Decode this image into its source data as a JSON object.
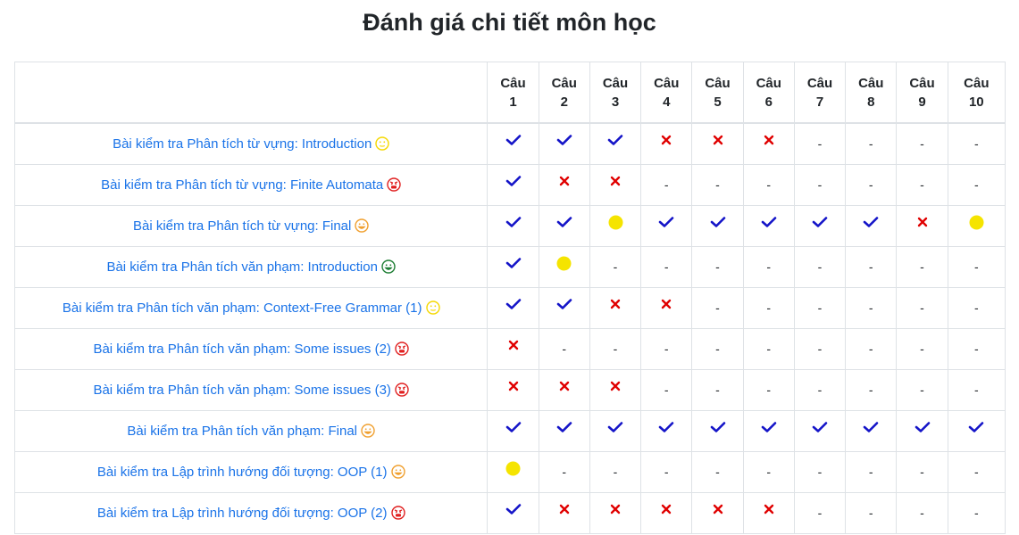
{
  "page": {
    "title": "Đánh giá chi tiết môn học"
  },
  "table": {
    "headers": [
      "Câu\n1",
      "Câu\n2",
      "Câu\n3",
      "Câu\n4",
      "Câu\n5",
      "Câu\n6",
      "Câu\n7",
      "Câu\n8",
      "Câu\n9",
      "Câu\n10"
    ],
    "header_top": "Câu",
    "header_numbers": [
      "1",
      "2",
      "3",
      "4",
      "5",
      "6",
      "7",
      "8",
      "9",
      "10"
    ],
    "rows": [
      {
        "name": "Bài kiểm tra Phân tích từ vựng: Introduction",
        "face": "neutral",
        "marks": [
          "check",
          "check",
          "check",
          "cross",
          "cross",
          "cross",
          "dash",
          "dash",
          "dash",
          "dash"
        ]
      },
      {
        "name": "Bài kiểm tra Phân tích từ vựng: Finite Automata",
        "face": "angry",
        "marks": [
          "check",
          "cross",
          "cross",
          "dash",
          "dash",
          "dash",
          "dash",
          "dash",
          "dash",
          "dash"
        ]
      },
      {
        "name": "Bài kiểm tra Phân tích từ vựng: Final",
        "face": "smile",
        "marks": [
          "check",
          "check",
          "dot",
          "check",
          "check",
          "check",
          "check",
          "check",
          "cross",
          "dot"
        ]
      },
      {
        "name": "Bài kiểm tra Phân tích văn phạm: Introduction",
        "face": "happy",
        "marks": [
          "check",
          "dot",
          "dash",
          "dash",
          "dash",
          "dash",
          "dash",
          "dash",
          "dash",
          "dash"
        ]
      },
      {
        "name": "Bài kiểm tra Phân tích văn phạm: Context-Free Grammar (1)",
        "face": "neutral",
        "marks": [
          "check",
          "check",
          "cross",
          "cross",
          "dash",
          "dash",
          "dash",
          "dash",
          "dash",
          "dash"
        ]
      },
      {
        "name": "Bài kiểm tra Phân tích văn phạm: Some issues (2)",
        "face": "angry",
        "marks": [
          "cross",
          "dash",
          "dash",
          "dash",
          "dash",
          "dash",
          "dash",
          "dash",
          "dash",
          "dash"
        ]
      },
      {
        "name": "Bài kiểm tra Phân tích văn phạm: Some issues (3)",
        "face": "angry",
        "marks": [
          "cross",
          "cross",
          "cross",
          "dash",
          "dash",
          "dash",
          "dash",
          "dash",
          "dash",
          "dash"
        ]
      },
      {
        "name": "Bài kiểm tra Phân tích văn phạm: Final",
        "face": "smile",
        "marks": [
          "check",
          "check",
          "check",
          "check",
          "check",
          "check",
          "check",
          "check",
          "check",
          "check"
        ]
      },
      {
        "name": "Bài kiểm tra Lập trình hướng đối tượng: OOP (1)",
        "face": "smile",
        "marks": [
          "dot",
          "dash",
          "dash",
          "dash",
          "dash",
          "dash",
          "dash",
          "dash",
          "dash",
          "dash"
        ]
      },
      {
        "name": "Bài kiểm tra Lập trình hướng đối tượng: OOP (2)",
        "face": "angry",
        "marks": [
          "check",
          "cross",
          "cross",
          "cross",
          "cross",
          "cross",
          "dash",
          "dash",
          "dash",
          "dash"
        ]
      }
    ],
    "dash_text": "-"
  },
  "colors": {
    "link": "#1a73e8",
    "check": "#1414c8",
    "cross": "#e00000",
    "dot": "#f5e400",
    "face_neutral": "#f5d800",
    "face_angry": "#e02020",
    "face_smile": "#f0a030",
    "face_happy": "#1e7e34",
    "border": "#dee2e6"
  }
}
